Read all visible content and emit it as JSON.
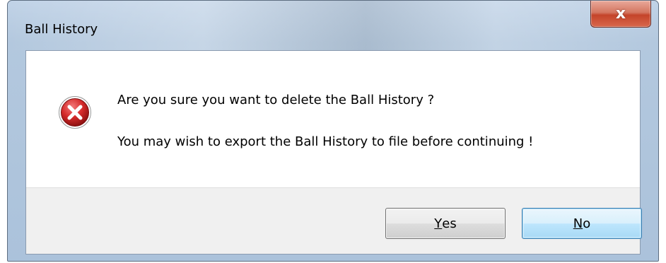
{
  "window": {
    "title": "Ball History"
  },
  "titlebar": {
    "close_glyph": "x"
  },
  "message": {
    "icon": "error-icon",
    "line1": "Are you sure you want to delete the Ball History ?",
    "line2": "You may wish to export the Ball History to file before continuing !"
  },
  "buttons": {
    "yes": {
      "accelerator": "Y",
      "rest": "es"
    },
    "no": {
      "accelerator": "N",
      "rest": "o"
    }
  },
  "colors": {
    "error_red": "#c8202a",
    "default_button_border": "#3c7fb1"
  }
}
